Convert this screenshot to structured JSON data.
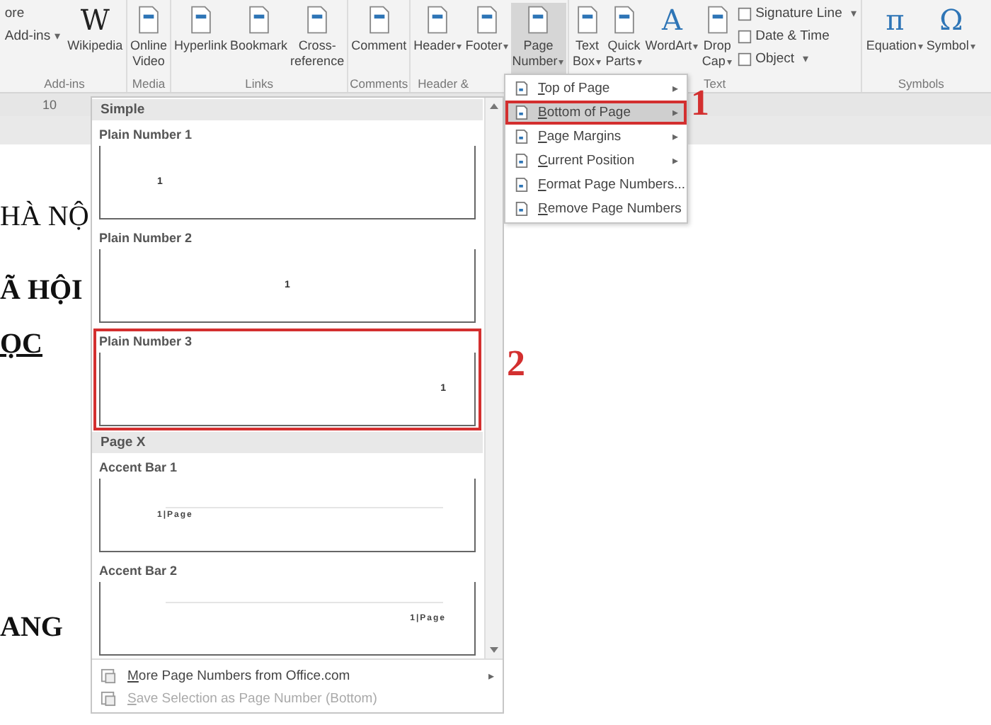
{
  "ribbon": {
    "groups": [
      {
        "label": "Add-ins",
        "commands": [
          {
            "label": "ore",
            "kind": "small"
          },
          {
            "label": "Add-ins",
            "kind": "small",
            "arrow": "▾"
          },
          {
            "label": "Wikipedia",
            "kind": "large",
            "glyph": "W",
            "selected": false
          }
        ]
      },
      {
        "label": "Media",
        "commands": [
          {
            "label": "Online Video",
            "kind": "large",
            "selected": false
          }
        ]
      },
      {
        "label": "Links",
        "commands": [
          {
            "label": "Hyperlink",
            "kind": "large",
            "selected": false
          },
          {
            "label": "Bookmark",
            "kind": "large",
            "selected": false
          },
          {
            "label": "Cross-reference",
            "kind": "large",
            "selected": false
          }
        ]
      },
      {
        "label": "Comments",
        "commands": [
          {
            "label": "Comment",
            "kind": "large",
            "selected": false
          }
        ]
      },
      {
        "label": "Header &",
        "commands": [
          {
            "label": "Header",
            "kind": "large",
            "arrow": "▾",
            "selected": false
          },
          {
            "label": "Footer",
            "kind": "large",
            "arrow": "▾",
            "selected": false
          },
          {
            "label": "Page Number",
            "kind": "large",
            "arrow": "▾",
            "selected": true
          }
        ]
      },
      {
        "label": "Text",
        "commands": [
          {
            "label": "Text Box",
            "kind": "large",
            "arrow": "▾",
            "selected": false
          },
          {
            "label": "Quick Parts",
            "kind": "large",
            "arrow": "▾",
            "selected": false
          },
          {
            "label": "WordArt",
            "kind": "large",
            "glyph": "A",
            "arrow": "▾",
            "selected": false
          },
          {
            "label": "Drop Cap",
            "kind": "large",
            "arrow": "▾",
            "selected": false
          },
          {
            "label": "Signature Line",
            "kind": "small",
            "arrow": "▾"
          },
          {
            "label": "Date & Time",
            "kind": "small"
          },
          {
            "label": "Object",
            "kind": "small",
            "arrow": "▾"
          }
        ]
      },
      {
        "label": "Symbols",
        "commands": [
          {
            "label": "Equation",
            "kind": "large",
            "glyph": "π",
            "arrow": "▾",
            "selected": false
          },
          {
            "label": "Symbol",
            "kind": "large",
            "glyph": "Ω",
            "arrow": "▾",
            "selected": false
          }
        ]
      }
    ]
  },
  "ruler": {
    "mark": "10"
  },
  "document": {
    "lines": [
      "HÀ NỘ",
      "Ã HỘI",
      "ỌC",
      "ANG"
    ]
  },
  "menu": {
    "items": [
      {
        "label": "Top of Page",
        "arrow": "▸",
        "selected": false
      },
      {
        "label": "Bottom of Page",
        "arrow": "▸",
        "selected": true
      },
      {
        "label": "Page Margins",
        "arrow": "▸",
        "selected": false
      },
      {
        "label": "Current Position",
        "arrow": "▸",
        "selected": false
      },
      {
        "label": "Format Page Numbers...",
        "selected": false
      },
      {
        "label": "Remove Page Numbers",
        "selected": false
      }
    ]
  },
  "gallery": {
    "sections": [
      {
        "heading": "Simple",
        "items": [
          {
            "label": "Plain Number 1",
            "number": "1",
            "kind": "left",
            "accent": false,
            "selected": false
          },
          {
            "label": "Plain Number 2",
            "number": "1",
            "kind": "center",
            "accent": false,
            "selected": false
          },
          {
            "label": "Plain Number 3",
            "number": "1",
            "kind": "right",
            "accent": false,
            "selected": true
          }
        ]
      },
      {
        "heading": "Page X",
        "items": [
          {
            "label": "Accent Bar 1",
            "number": "1|Page",
            "kind": "left",
            "accent": true,
            "selected": false
          },
          {
            "label": "Accent Bar 2",
            "number": "1|Page",
            "kind": "right",
            "accent": true,
            "selected": false
          }
        ]
      }
    ],
    "footer": [
      {
        "label": "More Page Numbers from Office.com",
        "arrow": "▸",
        "disabled": false
      },
      {
        "label": "Save Selection as Page Number (Bottom)",
        "disabled": true
      }
    ]
  },
  "annotations": [
    "1",
    "2"
  ]
}
